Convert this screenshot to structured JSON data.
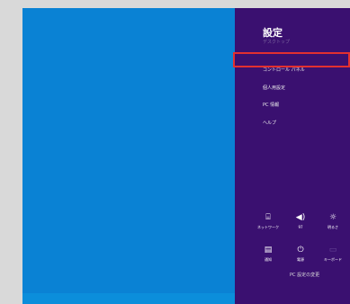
{
  "settings_charm": {
    "title": "設定",
    "subtitle": "デスクトップ",
    "menu": [
      {
        "label": "コントロール パネル"
      },
      {
        "label": "個人用設定"
      },
      {
        "label": "PC 情報"
      },
      {
        "label": "ヘルプ"
      }
    ],
    "quick_tiles": [
      {
        "icon": "network-icon",
        "glyph": "⌸",
        "label": "ネットワーク"
      },
      {
        "icon": "volume-icon",
        "glyph": "◀)",
        "label": "97"
      },
      {
        "icon": "brightness-icon",
        "glyph": "☼",
        "label": "明るさ"
      },
      {
        "icon": "notifications-icon",
        "glyph": "▤",
        "label": "通知"
      },
      {
        "icon": "power-icon",
        "glyph": "⏻",
        "label": "電源"
      },
      {
        "icon": "keyboard-icon",
        "glyph": "▭",
        "label": "キーボード"
      }
    ],
    "footer": "PC 設定の変更"
  },
  "colors": {
    "desktop": "#0a82d4",
    "charm": "#3a1070",
    "highlight": "#e23030"
  }
}
